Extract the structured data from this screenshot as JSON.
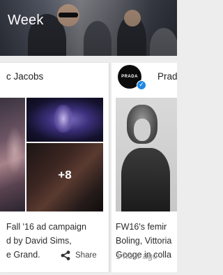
{
  "hero": {
    "title": "Week"
  },
  "cards": [
    {
      "author": "c Jacobs",
      "more_count": "+8",
      "text_lines": [
        "Fall '16 ad campaign",
        "d by David Sims,",
        "e Grand."
      ],
      "share_label": "Share",
      "icons": {
        "share": "share-icon"
      }
    },
    {
      "author": "Prad",
      "avatar_text": "PRADA",
      "text_lines": [
        "FW16's femir",
        "Boling, Vittoria",
        "Googe in colla"
      ],
      "timestamp": "1 hour ago",
      "icons": {
        "verified": "verified-badge-icon"
      }
    }
  ],
  "colors": {
    "verified": "#1e88e5",
    "timestamp": "#9a9a9a",
    "background": "#ededed"
  }
}
